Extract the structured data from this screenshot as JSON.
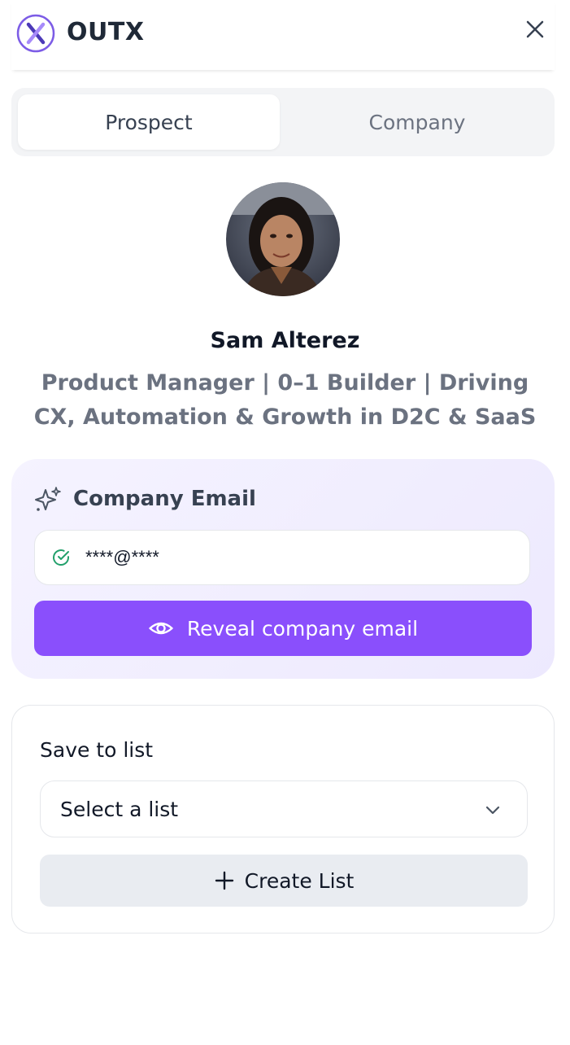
{
  "app": {
    "brand": "OUTX"
  },
  "tabs": [
    {
      "label": "Prospect",
      "active": true
    },
    {
      "label": "Company",
      "active": false
    }
  ],
  "profile": {
    "name": "Sam Alterez",
    "headline_line1": "Product Manager | 0–1 Builder | Driving",
    "headline_line2": "CX, Automation & Growth in D2C & SaaS"
  },
  "email": {
    "title": "Company Email",
    "masked_value": "****@****",
    "reveal_label": "Reveal company email"
  },
  "list": {
    "title": "Save to list",
    "select_value": "Select a list",
    "create_label": "Create List"
  },
  "colors": {
    "accent": "#8a4ffc",
    "verified": "#22a06b"
  }
}
